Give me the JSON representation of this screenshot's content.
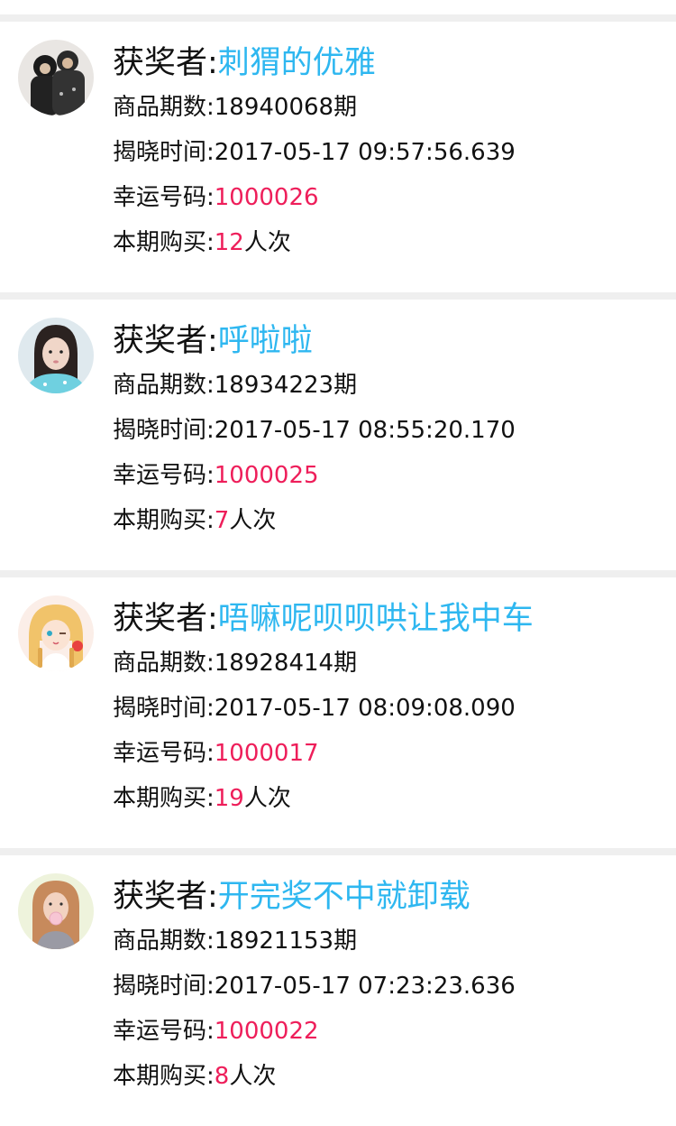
{
  "labels": {
    "winner": "获奖者:",
    "issue": "商品期数:",
    "reveal_time": "揭晓时间:",
    "lucky_number": "幸运号码:",
    "purchase": "本期购买:",
    "times_unit": "人次"
  },
  "colors": {
    "name": "#2eb7f0",
    "highlight": "#ee1e5a",
    "divider": "#efefef"
  },
  "records": [
    {
      "winner_name": "刺猬的优雅",
      "issue": "18940068期",
      "reveal_time": "2017-05-17 09:57:56.639",
      "lucky_number": "1000026",
      "purchase_count": "12",
      "avatar_icon": "user-avatar-couple-dark"
    },
    {
      "winner_name": "呼啦啦",
      "issue": "18934223期",
      "reveal_time": "2017-05-17 08:55:20.170",
      "lucky_number": "1000025",
      "purchase_count": "7",
      "avatar_icon": "user-avatar-girl-portrait"
    },
    {
      "winner_name": "唔嘛呢呗呗哄让我中车",
      "issue": "18928414期",
      "reveal_time": "2017-05-17 08:09:08.090",
      "lucky_number": "1000017",
      "purchase_count": "19",
      "avatar_icon": "user-avatar-anime-girl"
    },
    {
      "winner_name": "开完奖不中就卸载",
      "issue": "18921153期",
      "reveal_time": "2017-05-17 07:23:23.636",
      "lucky_number": "1000022",
      "purchase_count": "8",
      "avatar_icon": "user-avatar-girl-bubblegum"
    }
  ]
}
